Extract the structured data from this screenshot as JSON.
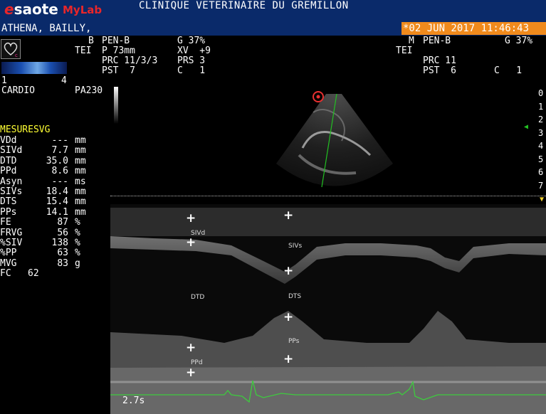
{
  "header": {
    "logo_brand": "esaote",
    "logo_product": "MyLab",
    "clinic": "CLINIQUE VETERINAIRE DU GREMILLON",
    "patient": "ATHENA, BAILLY,",
    "datetime": "*02 JUN 2017 11:46:43"
  },
  "params_left": {
    "row1": [
      "B",
      "PEN-B",
      "G 37%"
    ],
    "row2": [
      "TEI",
      "P 73mm",
      "XV  +9"
    ],
    "row3": [
      "PRC 11/3/3",
      "PRS 3"
    ],
    "row4": [
      "PST  7",
      "C   1"
    ]
  },
  "params_right": {
    "row1": [
      "M",
      "PEN-B",
      "G 37%"
    ],
    "row2": [
      "TEI"
    ],
    "row3": [
      "PRC 11"
    ],
    "row4": [
      "PST  6",
      "C   1"
    ]
  },
  "left_panel": {
    "scale_min": "1",
    "scale_max": "4",
    "mode": "CARDIO",
    "probe": "PA230"
  },
  "measurements": {
    "title": "MESURESVG",
    "rows": [
      {
        "name": "VDd",
        "value": "---",
        "unit": "mm"
      },
      {
        "name": "SIVd",
        "value": "7.7",
        "unit": "mm"
      },
      {
        "name": "DTD",
        "value": "35.0",
        "unit": "mm"
      },
      {
        "name": "PPd",
        "value": "8.6",
        "unit": "mm"
      },
      {
        "name": "Asyn",
        "value": "---",
        "unit": "ms"
      },
      {
        "name": "SIVs",
        "value": "18.4",
        "unit": "mm"
      },
      {
        "name": "DTS",
        "value": "15.4",
        "unit": "mm"
      },
      {
        "name": "PPs",
        "value": "14.1",
        "unit": "mm"
      },
      {
        "name": "FE",
        "value": "87",
        "unit": "%"
      },
      {
        "name": "FRVG",
        "value": "56",
        "unit": "%"
      },
      {
        "name": "%SIV",
        "value": "138",
        "unit": "%"
      },
      {
        "name": "%PP",
        "value": "63",
        "unit": "%"
      },
      {
        "name": "MVG",
        "value": "83",
        "unit": "g"
      }
    ],
    "fc_label": "FC",
    "fc_value": "62"
  },
  "depth_scale": [
    "0",
    "1",
    "2",
    "3",
    "4",
    "5",
    "6",
    "7"
  ],
  "mmode_labels": {
    "sivd": "SIVd",
    "sivs": "SIVs",
    "dtd": "DTD",
    "dts": "DTS",
    "ppd": "PPd",
    "pps": "PPs"
  },
  "sweep_time": "2.7s",
  "colors": {
    "header_bg": "#0a2a6a",
    "datetime_bg": "#f08a1c",
    "measurement_title": "#ffff33",
    "ecg_trace": "#3ecb3e",
    "cursor_line": "#22c022"
  }
}
